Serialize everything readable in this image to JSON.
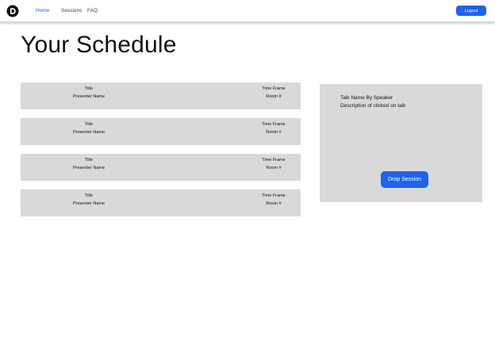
{
  "nav": {
    "logo_icon": "d-logo-icon",
    "links": [
      {
        "label": "Home",
        "active": true
      },
      {
        "label": "Sessions",
        "active": false
      },
      {
        "label": "FAQ",
        "active": false
      }
    ],
    "logout_label": "Logout",
    "accent_color": "#1f63e8"
  },
  "page": {
    "title": "Your Schedule"
  },
  "sessions": [
    {
      "title": "Title",
      "presenter": "Presenter Name",
      "time_frame": "Time Frame",
      "room": "Room #"
    },
    {
      "title": "Title",
      "presenter": "Presenter Name",
      "time_frame": "Time Frame",
      "room": "Room #"
    },
    {
      "title": "Title",
      "presenter": "Presenter Name",
      "time_frame": "Time Frame",
      "room": "Room #"
    },
    {
      "title": "Title",
      "presenter": "Presenter Name",
      "time_frame": "Time Frame",
      "room": "Room #"
    }
  ],
  "detail": {
    "talk_line": "Talk Name By Speaker",
    "description": "Description of clicked on talk",
    "drop_label": "Drop Session"
  },
  "colors": {
    "panel_gray": "#d9d9d9",
    "button_blue": "#1f63e8",
    "active_link": "#2461e6"
  }
}
